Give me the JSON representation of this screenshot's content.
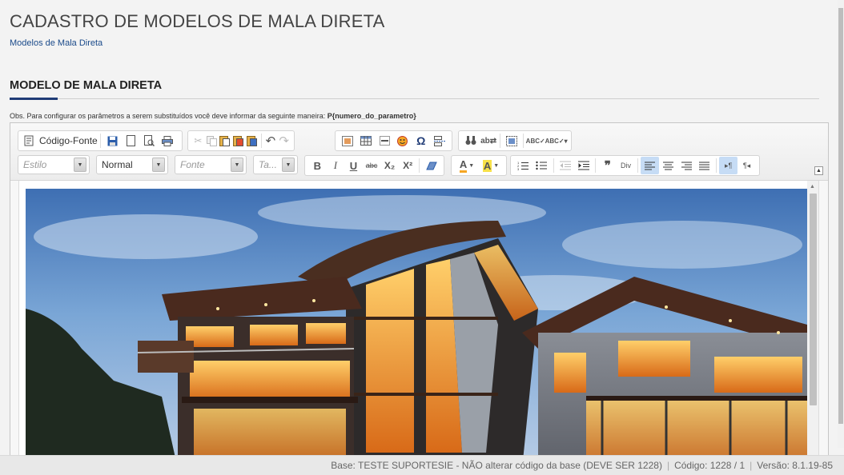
{
  "page": {
    "title": "CADASTRO DE MODELOS DE MALA DIRETA",
    "breadcrumb": "Modelos de Mala Direta"
  },
  "section": {
    "title": "MODELO DE MALA DIRETA",
    "obs_text": "Obs. Para configurar os parâmetros a serem substituídos você deve informar da seguinte maneira: ",
    "obs_param": "P{numero_do_parametro}"
  },
  "toolbar": {
    "source_label": "Código-Fonte",
    "combos": {
      "style": "Estilo",
      "format": "Normal",
      "font": "Fonte",
      "size": "Ta..."
    },
    "icons": {
      "bold": "B",
      "italic": "I",
      "underline": "U",
      "strike": "abc",
      "subscript": "X₂",
      "superscript": "X²",
      "text_color": "A",
      "bg_color": "A",
      "ltr": "▸¶",
      "rtl": "¶◂"
    }
  },
  "footer": {
    "base": "Base: TESTE SUPORTESIE - NÃO alterar código da base (DEVE SER 1228)",
    "code": "Código: 1228 / 1",
    "version": "Versão: 8.1.19-85"
  },
  "colors": {
    "accent": "#1f3b76",
    "active_button": "#c6dcf5"
  }
}
